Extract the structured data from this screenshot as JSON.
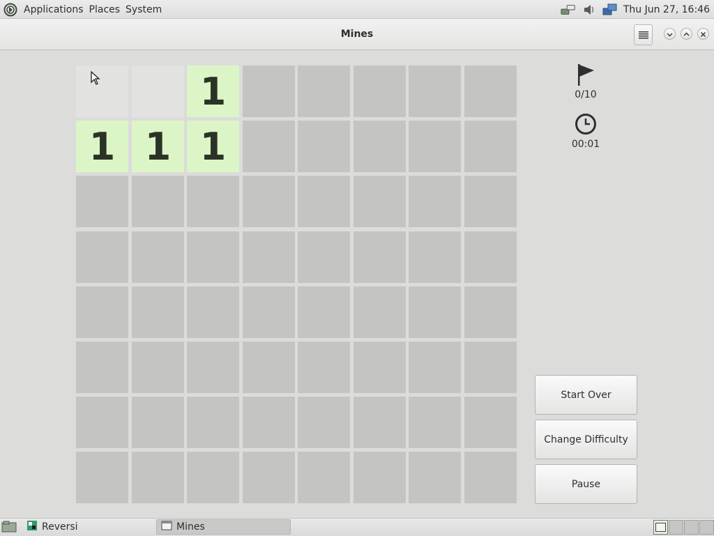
{
  "top_panel": {
    "menus": [
      "Applications",
      "Places",
      "System"
    ],
    "clock": "Thu Jun 27, 16:46",
    "icons": [
      "distro-logo-icon",
      "network-icon",
      "volume-icon",
      "display-icon"
    ]
  },
  "window": {
    "title": "Mines",
    "buttons": [
      "menu-icon",
      "minimize-icon",
      "maximize-icon",
      "close-icon"
    ]
  },
  "game": {
    "rows": 8,
    "cols": 8,
    "board": [
      [
        "e",
        "e",
        "1",
        "u",
        "u",
        "u",
        "u",
        "u"
      ],
      [
        "1",
        "1",
        "1",
        "u",
        "u",
        "u",
        "u",
        "u"
      ],
      [
        "u",
        "u",
        "u",
        "u",
        "u",
        "u",
        "u",
        "u"
      ],
      [
        "u",
        "u",
        "u",
        "u",
        "u",
        "u",
        "u",
        "u"
      ],
      [
        "u",
        "u",
        "u",
        "u",
        "u",
        "u",
        "u",
        "u"
      ],
      [
        "u",
        "u",
        "u",
        "u",
        "u",
        "u",
        "u",
        "u"
      ],
      [
        "u",
        "u",
        "u",
        "u",
        "u",
        "u",
        "u",
        "u"
      ],
      [
        "u",
        "u",
        "u",
        "u",
        "u",
        "u",
        "u",
        "u"
      ]
    ],
    "flags": "0/10",
    "time": "00:01",
    "buttons": {
      "start_over": "Start Over",
      "change_difficulty": "Change Difficulty",
      "pause": "Pause"
    }
  },
  "taskbar": {
    "tasks": [
      {
        "label": "Reversi",
        "active": false
      },
      {
        "label": "Mines",
        "active": true
      }
    ],
    "workspaces": 4,
    "active_workspace": 1
  },
  "colors": {
    "unrevealed": "#c4c4c1",
    "cleared": "#e2e2e0",
    "number_cell": "#dcf5c6",
    "number_text": "#2b3326"
  }
}
